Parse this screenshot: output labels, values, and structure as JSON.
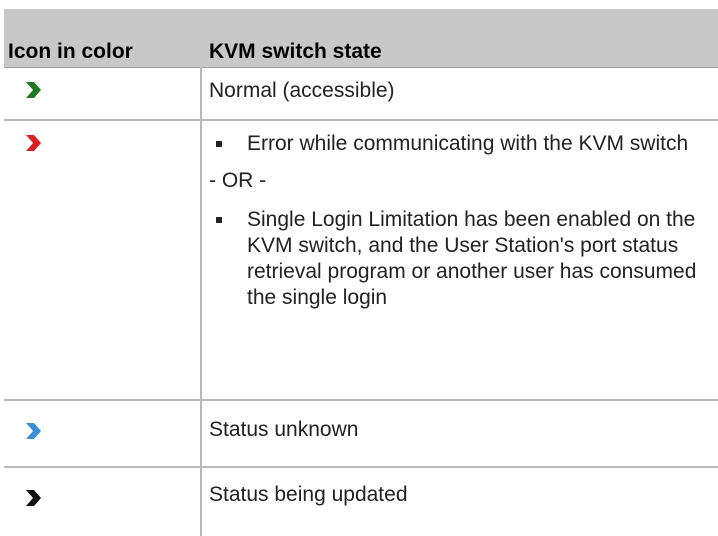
{
  "table": {
    "headers": [
      "Icon in color",
      "KVM switch state"
    ],
    "rows": [
      {
        "icon": "green-chevron-icon",
        "icon_color": "#1f7a1f",
        "state": "Normal (accessible)"
      },
      {
        "icon": "red-chevron-icon",
        "icon_color": "#d81e1e",
        "bullet_1": "Error while communicating with the KVM switch",
        "or_text": "- OR -",
        "bullet_2": "Single Login Limitation has been enabled on the KVM switch, and the User Station's port status retrieval program or another user has consumed the single login"
      },
      {
        "icon": "blue-chevron-icon",
        "icon_color": "#3a8fd6",
        "state": "Status unknown"
      },
      {
        "icon": "black-chevron-icon",
        "icon_color": "#111111",
        "state": "Status being updated"
      }
    ]
  }
}
